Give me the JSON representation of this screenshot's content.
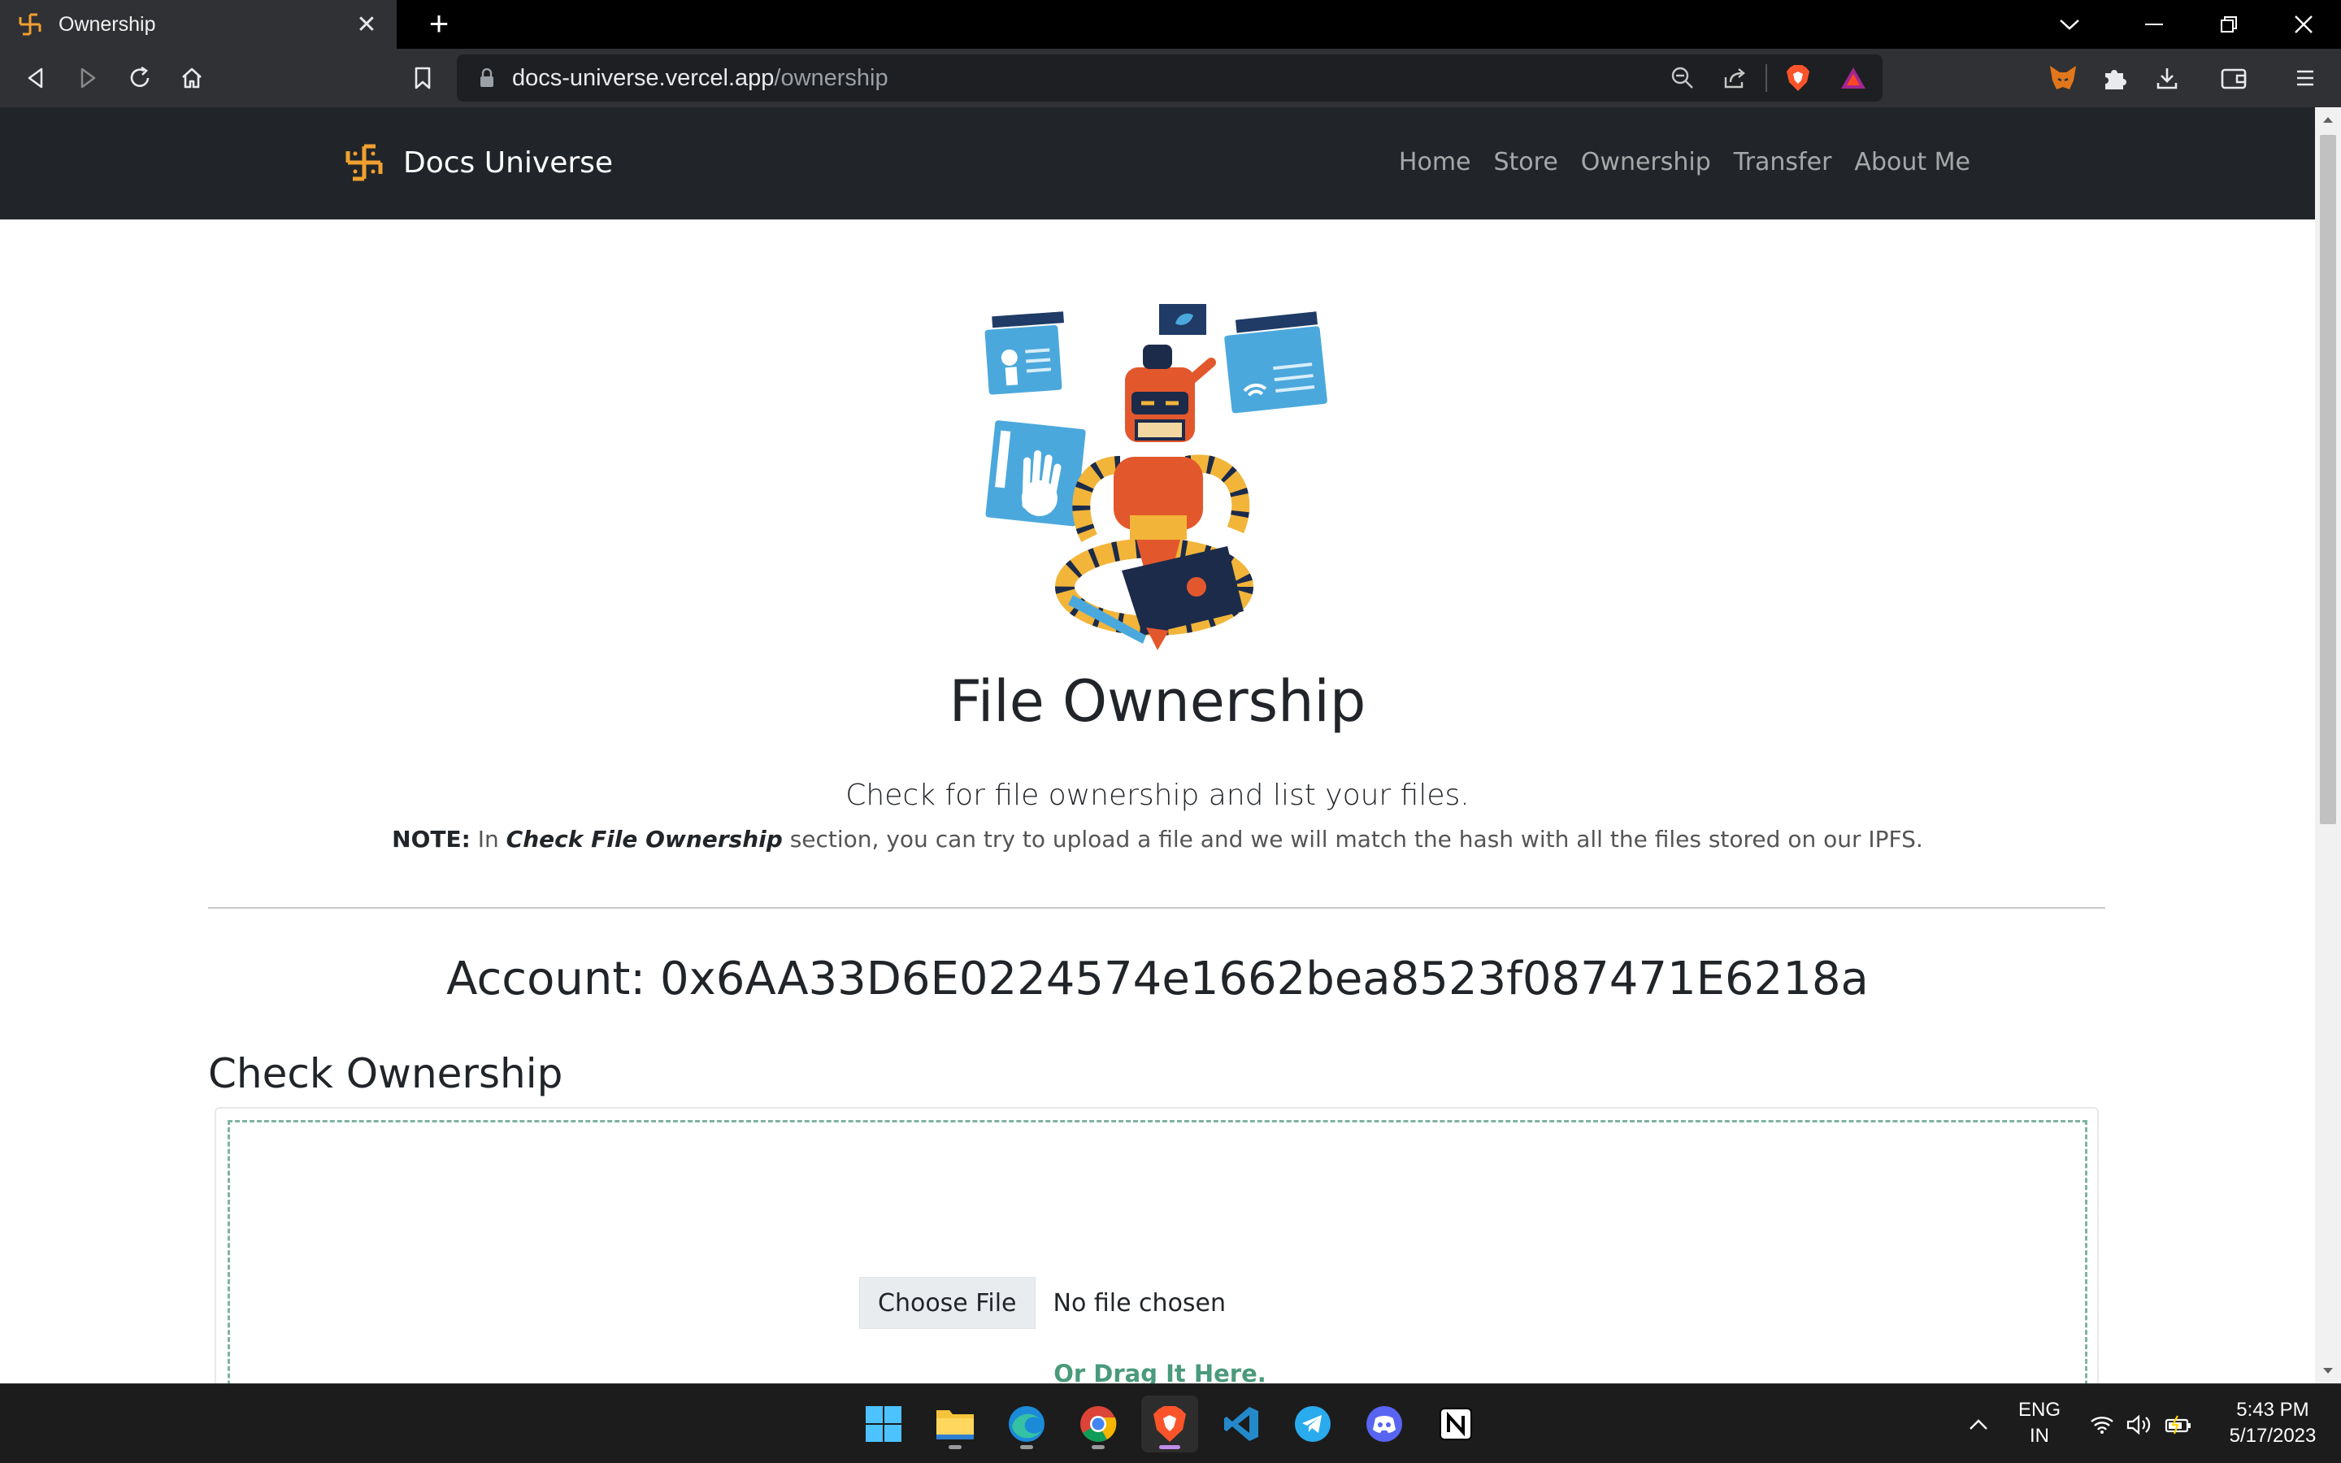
{
  "browser": {
    "tab_title": "Ownership",
    "url_host": "docs-universe.vercel.app",
    "url_path": "/ownership"
  },
  "site": {
    "brand": "Docs Universe",
    "nav": [
      "Home",
      "Store",
      "Ownership",
      "Transfer",
      "About Me"
    ]
  },
  "hero": {
    "title": "File Ownership",
    "subtitle": "Check for file ownership and list your files.",
    "note_label": "NOTE:",
    "note_prefix": " In ",
    "note_emphasis": "Check File Ownership",
    "note_suffix": " section, you can try to upload a file and we will match the hash with all the files stored on our IPFS."
  },
  "account": {
    "text": "Account: 0x6AA33D6E0224574e1662bea8523f087471E6218a"
  },
  "check_ownership": {
    "heading": "Check Ownership",
    "choose_file_label": "Choose File",
    "no_file_text": "No file chosen",
    "drag_text": "Or Drag It Here."
  },
  "taskbar": {
    "lang_top": "ENG",
    "lang_bottom": "IN",
    "time": "5:43 PM",
    "date": "5/17/2023"
  },
  "colors": {
    "site_nav_bg": "#212529",
    "brand_logo": "#f0a030",
    "drag_text": "#4a9a7c",
    "browser_chrome": "#303134"
  },
  "icons": {
    "tab_favicon": "swastika-logo-icon",
    "taskbar_apps": [
      "windows-start-icon",
      "file-explorer-icon",
      "edge-icon",
      "chrome-icon",
      "brave-icon",
      "vscode-icon",
      "telegram-icon",
      "discord-icon",
      "notion-icon"
    ]
  }
}
